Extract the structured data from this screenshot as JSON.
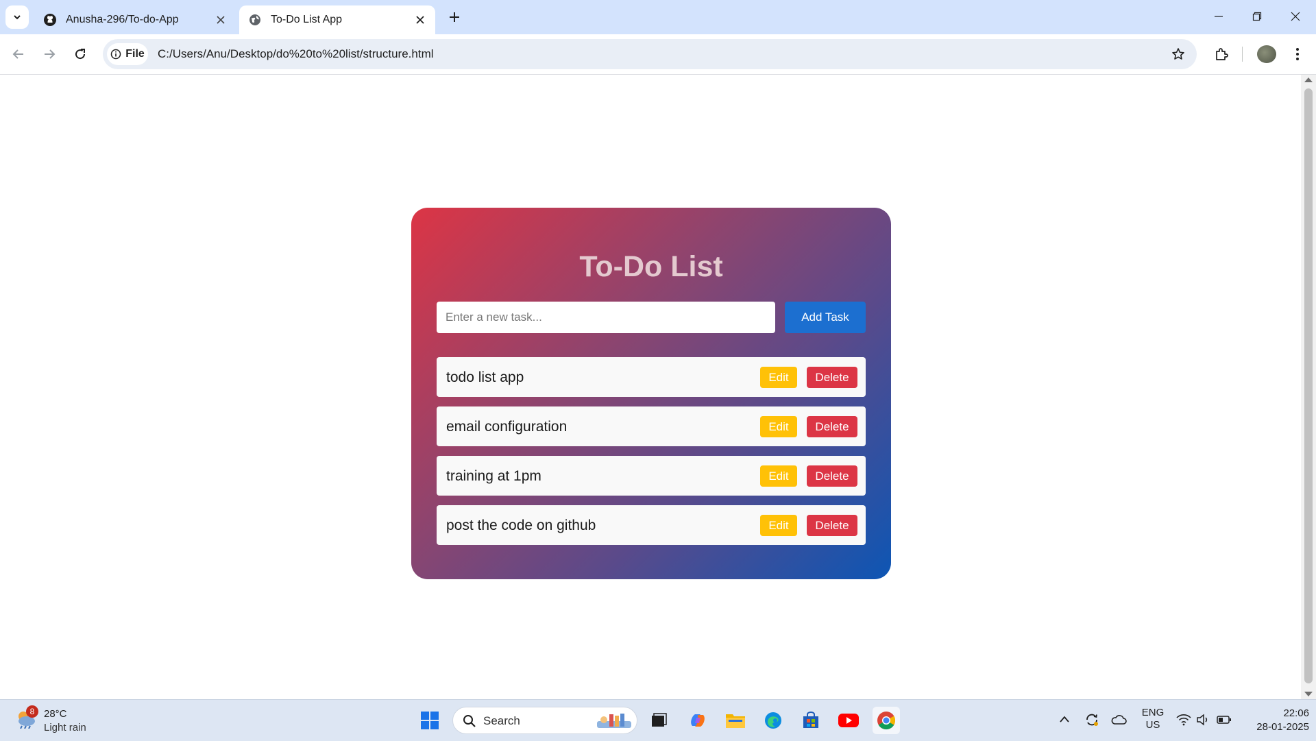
{
  "browser": {
    "tabs": [
      {
        "title": "Anusha-296/To-do-App",
        "icon": "github-icon",
        "active": false
      },
      {
        "title": "To-Do List App",
        "icon": "globe-icon",
        "active": true
      }
    ],
    "omnibox": {
      "chip_label": "File",
      "url": "C:/Users/Anu/Desktop/do%20to%20list/structure.html"
    }
  },
  "app": {
    "title": "To-Do List",
    "input_placeholder": "Enter a new task...",
    "add_button": "Add Task",
    "tasks": [
      {
        "text": "todo list app",
        "edit": "Edit",
        "delete": "Delete"
      },
      {
        "text": "email configuration",
        "edit": "Edit",
        "delete": "Delete"
      },
      {
        "text": "training at 1pm",
        "edit": "Edit",
        "delete": "Delete"
      },
      {
        "text": "post the code on github",
        "edit": "Edit",
        "delete": "Delete"
      }
    ],
    "colors": {
      "gradient_start": "#dc3545",
      "gradient_end": "#0d56b4",
      "add_button": "#1c6fd0",
      "edit_button": "#ffc107",
      "delete_button": "#dc3545"
    }
  },
  "taskbar": {
    "weather": {
      "badge": "8",
      "temp": "28°C",
      "condition": "Light rain"
    },
    "search_label": "Search",
    "language": {
      "line1": "ENG",
      "line2": "US"
    },
    "clock": {
      "time": "22:06",
      "date": "28-01-2025"
    }
  }
}
